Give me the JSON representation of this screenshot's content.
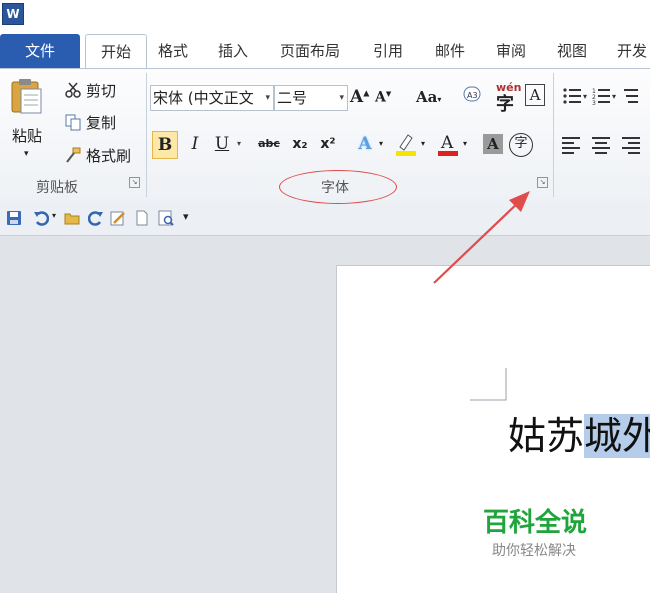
{
  "app": {
    "logo_letter": "W"
  },
  "tabs": [
    {
      "label": "文件"
    },
    {
      "label": "开始"
    },
    {
      "label": "格式"
    },
    {
      "label": "插入"
    },
    {
      "label": "页面布局"
    },
    {
      "label": "引用"
    },
    {
      "label": "邮件"
    },
    {
      "label": "审阅"
    },
    {
      "label": "视图"
    },
    {
      "label": "开发"
    }
  ],
  "clipboard": {
    "paste_label": "粘贴",
    "cut_label": "剪切",
    "copy_label": "复制",
    "format_painter_label": "格式刷",
    "group_label": "剪贴板"
  },
  "font": {
    "font_name": "宋体 (中文正文",
    "font_size": "二号",
    "case_label": "Aa",
    "phonetic_label": "wén",
    "border_label": "A",
    "group_label": "字体",
    "bold": "B",
    "italic": "I",
    "underline": "U",
    "strike": "abc",
    "subscript": "x₂",
    "superscript": "x²",
    "char_shading": "A",
    "enclose": "字"
  },
  "document": {
    "text_plain": "姑苏",
    "text_selected": "城外"
  },
  "watermark": {
    "title": "百科全说",
    "subtitle": "助你轻松解决"
  },
  "colors": {
    "accent": "#2a5db0",
    "highlight_ellipse": "#e04b4b",
    "watermark": "#1fa53b"
  }
}
